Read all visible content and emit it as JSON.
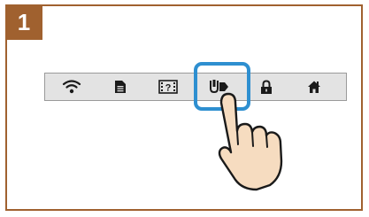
{
  "step": {
    "number": "1"
  },
  "toolbar": {
    "items": [
      {
        "icon": "wifi-icon"
      },
      {
        "icon": "document-icon"
      },
      {
        "icon": "help-icon"
      },
      {
        "icon": "usb-connect-icon"
      },
      {
        "icon": "lock-icon"
      },
      {
        "icon": "home-icon"
      }
    ]
  },
  "colors": {
    "accent": "#a0612f",
    "highlight": "#2e8fd0",
    "toolbar_bg": "#e3e3e3",
    "icon": "#1a1a1a",
    "hand_fill": "#f6dcc0"
  }
}
